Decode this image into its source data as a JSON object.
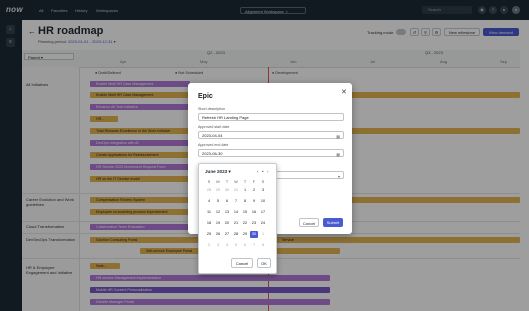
{
  "topbar": {
    "logo": "now",
    "nav": [
      "All",
      "Favorites",
      "History",
      "Workspaces"
    ],
    "workspace": "Alignment Workspace",
    "search_placeholder": "Search"
  },
  "header": {
    "title": "HR roadmap",
    "planning_label": "Planning period:",
    "planning_value": "2023-01-01 - 2023-12-31",
    "tracking_label": "Tracking mode",
    "new_milestone": "New milestone",
    "view_btn": "View demand"
  },
  "grid": {
    "parent_label": "Parent",
    "quarters": [
      "Q2 - 2023",
      "Q3 - 2023"
    ],
    "months": [
      "Apr",
      "May",
      "Jun",
      "Jul",
      "Aug",
      "Sep"
    ],
    "legend": [
      "Draft/Defined",
      "Not Scheduled",
      "Development"
    ],
    "rows": [
      "All Initiatives",
      "Career Evolution and Work guidelines",
      "Cloud Transformation",
      "DevSecOps Transformation",
      "HR & Employee Engagement and Initiative"
    ],
    "bars": [
      "Enable Multi HR Case Management",
      "Enable Multi HR Case Management",
      "Enhance All Tech Initiative",
      "HR...",
      "Total Rewards Excellence in the Work Initiative",
      "DevOps Integration with AI",
      "Create Applications for Reimbursement",
      "HR Service 2023 Investment Request Form",
      "HR on the IT Service model",
      "Compensation Review System",
      "Employee on-boarding process improvement",
      "Collaborative Team Evaluation",
      "Solution Consulting Portal",
      "Self-service Employee Portal",
      "Note...",
      "HR service Management Implementation",
      "Mobile HR Content Personalization",
      "Deloitte Manager Portal"
    ],
    "right_bar_labels": [
      "Service"
    ]
  },
  "modal": {
    "title": "Epic",
    "name_label": "Short description",
    "name_value": "Refresh HR Landing Page",
    "start_label": "Approved start date",
    "start_value": "2023-04-04",
    "end_label": "Approved end date",
    "end_value": "2023-06-30",
    "cancel": "Cancel",
    "submit": "Submit"
  },
  "calendar": {
    "month_label": "June 2023",
    "weekdays": [
      "S",
      "M",
      "T",
      "W",
      "T",
      "F",
      "S"
    ],
    "weeks": [
      [
        "28",
        "29",
        "30",
        "31",
        "1",
        "2",
        "3"
      ],
      [
        "4",
        "5",
        "6",
        "7",
        "8",
        "9",
        "10"
      ],
      [
        "11",
        "12",
        "13",
        "14",
        "15",
        "16",
        "17"
      ],
      [
        "18",
        "19",
        "20",
        "21",
        "22",
        "23",
        "24"
      ],
      [
        "25",
        "26",
        "27",
        "28",
        "29",
        "30",
        "1"
      ],
      [
        "2",
        "3",
        "4",
        "5",
        "6",
        "7",
        "8"
      ]
    ],
    "selected": "30",
    "cancel": "Cancel",
    "ok": "OK"
  },
  "colors": {
    "accent": "#4a5bd1",
    "bar_purple": "#b27ad8",
    "bar_orange": "#e6b552",
    "today": "#e05a5a"
  }
}
